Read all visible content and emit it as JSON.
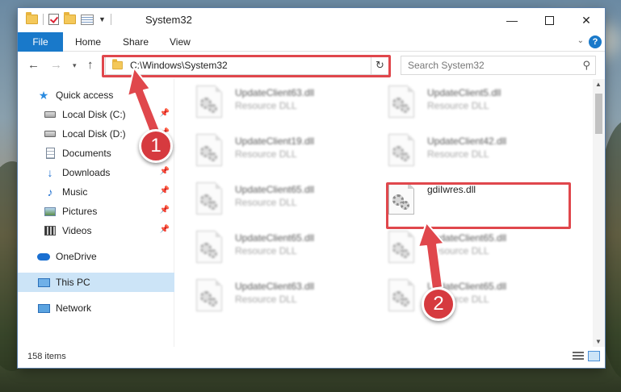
{
  "window": {
    "title": "System32",
    "controls": {
      "minimize": "—",
      "maximize": "",
      "close": "✕"
    }
  },
  "ribbon": {
    "tabs": [
      "File",
      "Home",
      "Share",
      "View"
    ],
    "expand_glyph": "⌄",
    "help_glyph": "?"
  },
  "nav": {
    "back": "←",
    "forward": "→",
    "recent": "▾",
    "up": "↑",
    "address": "C:\\Windows\\System32",
    "refresh": "↻",
    "search_placeholder": "Search System32",
    "search_glyph": "⚲"
  },
  "sidebar": {
    "items": [
      {
        "label": "Quick access",
        "icon": "star-icon",
        "pinned": false
      },
      {
        "label": "Local Disk (C:)",
        "icon": "drive-icon",
        "pinned": true
      },
      {
        "label": "Local Disk (D:)",
        "icon": "drive-icon",
        "pinned": true
      },
      {
        "label": "Documents",
        "icon": "documents-icon",
        "pinned": true
      },
      {
        "label": "Downloads",
        "icon": "download-icon",
        "pinned": true
      },
      {
        "label": "Music",
        "icon": "music-icon",
        "pinned": true
      },
      {
        "label": "Pictures",
        "icon": "pictures-icon",
        "pinned": true
      },
      {
        "label": "Videos",
        "icon": "videos-icon",
        "pinned": true
      },
      {
        "label": "OneDrive",
        "icon": "onedrive-icon",
        "pinned": false
      },
      {
        "label": "This PC",
        "icon": "this-pc-icon",
        "pinned": false,
        "selected": true
      },
      {
        "label": "Network",
        "icon": "network-icon",
        "pinned": false
      }
    ],
    "pin_glyph": "📌"
  },
  "files": {
    "items": [
      {
        "name": "UpdateClient63.dll",
        "type": "Resource DLL"
      },
      {
        "name": "UpdateClient5.dll",
        "type": "Resource DLL"
      },
      {
        "name": "UpdateClient19.dll",
        "type": "Resource DLL"
      },
      {
        "name": "UpdateClient42.dll",
        "type": "Resource DLL"
      },
      {
        "name": "UpdateClient65.dll",
        "type": "Resource DLL"
      },
      {
        "name": "gdiIwres.dll",
        "type": ""
      },
      {
        "name": "UpdateClient65.dll",
        "type": "Resource DLL"
      },
      {
        "name": "UpdateClient65.dll",
        "type": "Resource DLL"
      },
      {
        "name": "UpdateClient63.dll",
        "type": "Resource DLL"
      },
      {
        "name": "UpdateClient65.dll",
        "type": "Resource DLL"
      }
    ]
  },
  "status": {
    "item_count": "158 items"
  },
  "annotations": {
    "step1": "1",
    "step2": "2",
    "color": "#e0474c"
  }
}
